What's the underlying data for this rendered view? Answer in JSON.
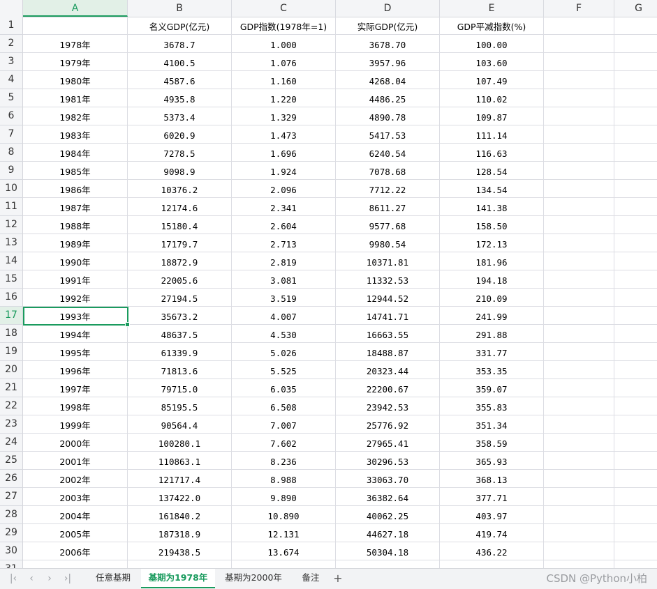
{
  "columns": [
    "A",
    "B",
    "C",
    "D",
    "E",
    "F",
    "G"
  ],
  "selected_column": "A",
  "header_row": {
    "row_number": "1",
    "a": "",
    "b": "名义GDP(亿元)",
    "c": "GDP指数(1978年=1)",
    "d": "实际GDP(亿元)",
    "e": "GDP平减指数(%)"
  },
  "rows": [
    {
      "n": "2",
      "a": "1978年",
      "b": "3678.7",
      "c": "1.000",
      "d": "3678.70",
      "e": "100.00"
    },
    {
      "n": "3",
      "a": "1979年",
      "b": "4100.5",
      "c": "1.076",
      "d": "3957.96",
      "e": "103.60"
    },
    {
      "n": "4",
      "a": "1980年",
      "b": "4587.6",
      "c": "1.160",
      "d": "4268.04",
      "e": "107.49"
    },
    {
      "n": "5",
      "a": "1981年",
      "b": "4935.8",
      "c": "1.220",
      "d": "4486.25",
      "e": "110.02"
    },
    {
      "n": "6",
      "a": "1982年",
      "b": "5373.4",
      "c": "1.329",
      "d": "4890.78",
      "e": "109.87"
    },
    {
      "n": "7",
      "a": "1983年",
      "b": "6020.9",
      "c": "1.473",
      "d": "5417.53",
      "e": "111.14"
    },
    {
      "n": "8",
      "a": "1984年",
      "b": "7278.5",
      "c": "1.696",
      "d": "6240.54",
      "e": "116.63"
    },
    {
      "n": "9",
      "a": "1985年",
      "b": "9098.9",
      "c": "1.924",
      "d": "7078.68",
      "e": "128.54"
    },
    {
      "n": "10",
      "a": "1986年",
      "b": "10376.2",
      "c": "2.096",
      "d": "7712.22",
      "e": "134.54"
    },
    {
      "n": "11",
      "a": "1987年",
      "b": "12174.6",
      "c": "2.341",
      "d": "8611.27",
      "e": "141.38"
    },
    {
      "n": "12",
      "a": "1988年",
      "b": "15180.4",
      "c": "2.604",
      "d": "9577.68",
      "e": "158.50"
    },
    {
      "n": "13",
      "a": "1989年",
      "b": "17179.7",
      "c": "2.713",
      "d": "9980.54",
      "e": "172.13"
    },
    {
      "n": "14",
      "a": "1990年",
      "b": "18872.9",
      "c": "2.819",
      "d": "10371.81",
      "e": "181.96"
    },
    {
      "n": "15",
      "a": "1991年",
      "b": "22005.6",
      "c": "3.081",
      "d": "11332.53",
      "e": "194.18"
    },
    {
      "n": "16",
      "a": "1992年",
      "b": "27194.5",
      "c": "3.519",
      "d": "12944.52",
      "e": "210.09"
    },
    {
      "n": "17",
      "a": "1993年",
      "b": "35673.2",
      "c": "4.007",
      "d": "14741.71",
      "e": "241.99"
    },
    {
      "n": "18",
      "a": "1994年",
      "b": "48637.5",
      "c": "4.530",
      "d": "16663.55",
      "e": "291.88"
    },
    {
      "n": "19",
      "a": "1995年",
      "b": "61339.9",
      "c": "5.026",
      "d": "18488.87",
      "e": "331.77"
    },
    {
      "n": "20",
      "a": "1996年",
      "b": "71813.6",
      "c": "5.525",
      "d": "20323.44",
      "e": "353.35"
    },
    {
      "n": "21",
      "a": "1997年",
      "b": "79715.0",
      "c": "6.035",
      "d": "22200.67",
      "e": "359.07"
    },
    {
      "n": "22",
      "a": "1998年",
      "b": "85195.5",
      "c": "6.508",
      "d": "23942.53",
      "e": "355.83"
    },
    {
      "n": "23",
      "a": "1999年",
      "b": "90564.4",
      "c": "7.007",
      "d": "25776.92",
      "e": "351.34"
    },
    {
      "n": "24",
      "a": "2000年",
      "b": "100280.1",
      "c": "7.602",
      "d": "27965.41",
      "e": "358.59"
    },
    {
      "n": "25",
      "a": "2001年",
      "b": "110863.1",
      "c": "8.236",
      "d": "30296.53",
      "e": "365.93"
    },
    {
      "n": "26",
      "a": "2002年",
      "b": "121717.4",
      "c": "8.988",
      "d": "33063.70",
      "e": "368.13"
    },
    {
      "n": "27",
      "a": "2003年",
      "b": "137422.0",
      "c": "9.890",
      "d": "36382.64",
      "e": "377.71"
    },
    {
      "n": "28",
      "a": "2004年",
      "b": "161840.2",
      "c": "10.890",
      "d": "40062.25",
      "e": "403.97"
    },
    {
      "n": "29",
      "a": "2005年",
      "b": "187318.9",
      "c": "12.131",
      "d": "44627.18",
      "e": "419.74"
    },
    {
      "n": "30",
      "a": "2006年",
      "b": "219438.5",
      "c": "13.674",
      "d": "50304.18",
      "e": "436.22"
    },
    {
      "n": "31",
      "a": "",
      "b": "",
      "c": "",
      "d": "",
      "e": ""
    }
  ],
  "active_cell_row": "17",
  "sheet_tabs": [
    "任意基期",
    "基期为1978年",
    "基期为2000年",
    "备注"
  ],
  "active_tab": "基期为1978年",
  "add_sheet_icon": "plus-icon",
  "watermark": "CSDN @Python小柏",
  "colors": {
    "accent": "#1a9b5e",
    "header_bg": "#f4f5f7",
    "grid": "#dcdde3"
  }
}
